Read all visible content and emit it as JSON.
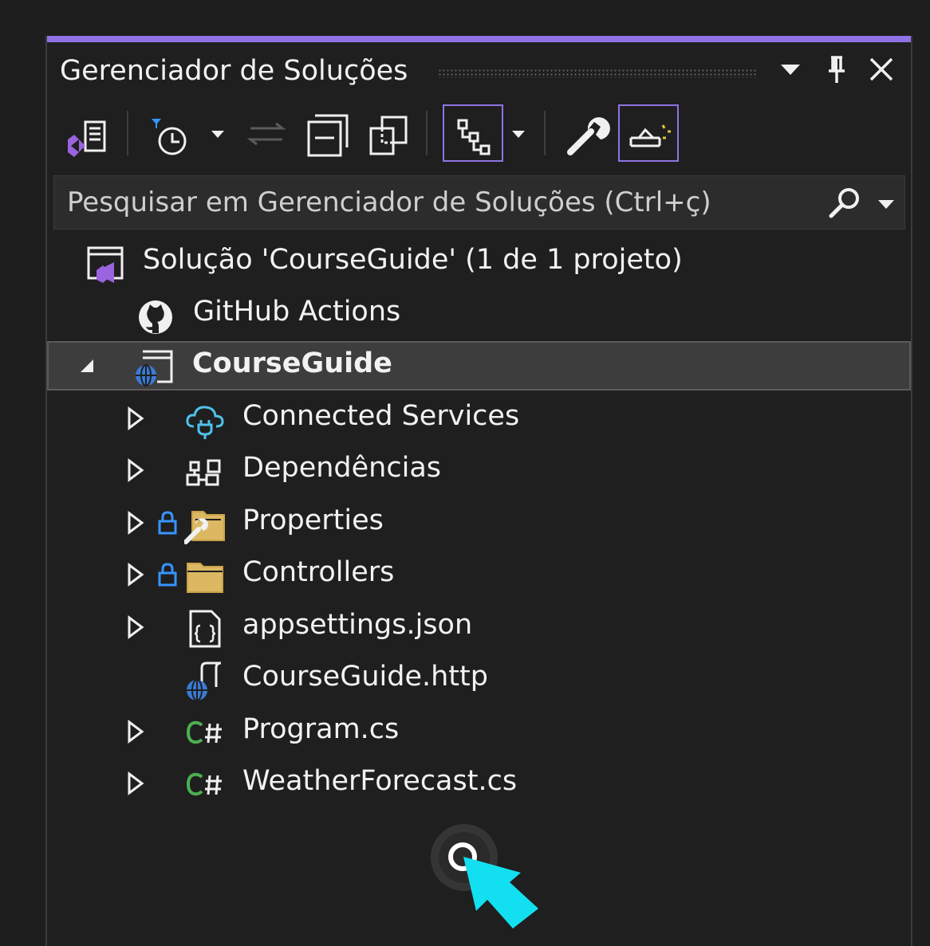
{
  "panel": {
    "title": "Gerenciador de Soluções",
    "accent_color": "#8f72e6",
    "title_buttons": [
      "dropdown-icon",
      "pin-icon",
      "close-icon"
    ]
  },
  "toolbar": {
    "buttons": [
      "switch-views-icon",
      "pending-changes-filter-icon",
      "sync-with-active-document-icon",
      "collapse-all-icon",
      "show-all-files-icon",
      "view-hierarchy-icon",
      "properties-wrench-icon",
      "preview-selected-items-icon"
    ]
  },
  "search": {
    "placeholder": "Pesquisar em Gerenciador de Soluções (Ctrl+ç)"
  },
  "tree": {
    "solution": {
      "label": "Solução 'CourseGuide' (1 de 1 projeto)",
      "icon": "solution-icon"
    },
    "github": {
      "label": "GitHub Actions",
      "icon": "github-icon"
    },
    "project": {
      "label": "CourseGuide",
      "icon": "web-project-icon",
      "expanded": true
    },
    "children": [
      {
        "label": "Connected Services",
        "icon": "connected-services-icon"
      },
      {
        "label": "Dependências",
        "icon": "dependencies-icon"
      },
      {
        "label": "Properties",
        "icon": "properties-folder-icon",
        "locked": true
      },
      {
        "label": "Controllers",
        "icon": "folder-icon",
        "locked": true
      },
      {
        "label": "appsettings.json",
        "icon": "json-file-icon"
      },
      {
        "label": "CourseGuide.http",
        "icon": "http-file-icon"
      },
      {
        "label": "Program.cs",
        "icon": "csharp-file-icon"
      },
      {
        "label": "WeatherForecast.cs",
        "icon": "csharp-file-icon"
      }
    ]
  }
}
